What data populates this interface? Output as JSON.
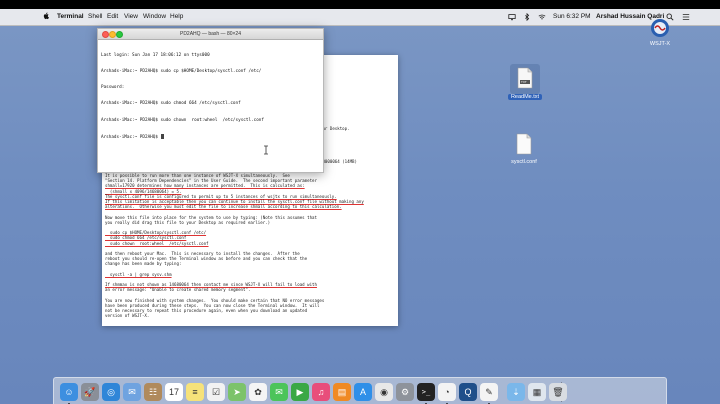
{
  "menubar": {
    "app_name": "Terminal",
    "menus": [
      "Shell",
      "Edit",
      "View",
      "Window",
      "Help"
    ],
    "clock": "Sun 6:32 PM",
    "user": "Arshad Hussain Qadri"
  },
  "desktop_icons": [
    {
      "label": "WSJT-X"
    },
    {
      "label": "ReadMe.txt",
      "badge": "TXT"
    },
    {
      "label": "sysctl.conf"
    }
  ],
  "terminal": {
    "title": "PD2AHQ — bash — 80×24",
    "lines": [
      "Last login: Sun Jan 17 18:06:12 on ttys000",
      "Arshads-iMac:~ PD2AHQ$ sudo cp $HOME/Desktop/sysctl.conf /etc/",
      "Password:",
      "Arshads-iMac:~ PD2AHQ$ sudo chmod 664 /etc/sysctl.conf",
      "Arshads-iMac:~ PD2AHQ$ sudo chown  root:wheel  /etc/sysctl.conf",
      "Arshads-iMac:~ PD2AHQ$ "
    ]
  },
  "readme": {
    "right_fragments": [
      "our Desktop.",
      "",
      "",
      "",
      "",
      "",
      "",
      "",
      "",
      "",
      "",
      "",
      "",
      "",
      "",
      "",
      "",
      "",
      "",
      "",
      "",
      "",
      "",
      "",
      "",
      "",
      "",
      "",
      "",
      "",
      "",
      "",
      "",
      "",
      "",
      "",
      "",
      "",
      "",
      "",
      "",
      "",
      "",
      "",
      "",
      "",
      "",
      "",
      "",
      ""
    ],
    "right_fragment_1": "our Desktop.",
    "right_fragment_2": "60000064 (14MB)",
    "lines": [
      "It is possible to run more than one instance of WSJT-X simultaneously.  See",
      "\"Section 14. Platform Dependencies\" in the User Guide.  The second important parameter",
      "shmall=17920 determines how many instances are permitted.  This is calculated as:",
      "  (shmall x 4096/14680064) = 5.",
      "The sysctl.conf file is configured to permit up to 5 instances of wsjtx to run simultaneously.",
      "If this limitation is acceptable then you can continue to install the sysctl.conf file without making any",
      "alterations.  Otherwise you must edit the file to increase shmall according to this calculation.",
      "",
      "Now move this file into place for the system to use by typing: (Note this assumes that",
      "you really did drag this file to your Desktop as required earlier.)",
      "",
      "  sudo cp $HOME/Desktop/sysctl.conf /etc/",
      "  sudo chmod 664 /etc/sysctl.conf",
      "  sudo chown  root:wheel  /etc/sysctl.conf",
      "",
      "and then reboot your Mac.  This is necessary to install the changes.  After the",
      "reboot you should re-open the Terminal window as before and you can check that the",
      "change has been made by typing:",
      "",
      "  sysctl -a | grep sysv.shm",
      "",
      "If shmmax is not shown as 14680064 then contact me since WSJT-X will fail to load with",
      "an error message: \"Unable to create shared memory segment\".",
      "",
      "You are now finished with system changes.  You should make certain that NO error messages",
      "have been produced during these steps.  You can now close the Terminal window.  It will",
      "not be necessary to repeat this procedure again, even when you download an updated",
      "version of WSJT-X."
    ]
  },
  "dock_items": [
    {
      "name": "finder",
      "color": "#3d8fe0",
      "glyph": "☺"
    },
    {
      "name": "launchpad",
      "color": "#8a8f98",
      "glyph": "🚀"
    },
    {
      "name": "safari",
      "color": "#2f86d8",
      "glyph": "◎"
    },
    {
      "name": "mail",
      "color": "#6fa3e0",
      "glyph": "✉"
    },
    {
      "name": "contacts",
      "color": "#b08a5c",
      "glyph": "☷"
    },
    {
      "name": "calendar",
      "color": "#ffffff",
      "glyph": "17",
      "dark": true
    },
    {
      "name": "notes",
      "color": "#f6e27a",
      "glyph": "≡",
      "dark": true
    },
    {
      "name": "reminders",
      "color": "#f2f2f2",
      "glyph": "☑",
      "dark": true
    },
    {
      "name": "maps",
      "color": "#7cc36a",
      "glyph": "➤"
    },
    {
      "name": "photos",
      "color": "#f5f5f5",
      "glyph": "✿",
      "dark": true
    },
    {
      "name": "messages",
      "color": "#4cc45a",
      "glyph": "✉"
    },
    {
      "name": "facetime",
      "color": "#3aa845",
      "glyph": "▶"
    },
    {
      "name": "itunes",
      "color": "#e84e7b",
      "glyph": "♫"
    },
    {
      "name": "ibooks",
      "color": "#f08a24",
      "glyph": "▤"
    },
    {
      "name": "app-store",
      "color": "#2f8fe8",
      "glyph": "A"
    },
    {
      "name": "chrome",
      "color": "#e8e8e8",
      "glyph": "◉",
      "dark": true
    },
    {
      "name": "system-preferences",
      "color": "#8e939b",
      "glyph": "⚙"
    },
    {
      "name": "terminal",
      "color": "#222222",
      "glyph": ">_"
    },
    {
      "name": "wsjt-x",
      "color": "#f3f3f3",
      "glyph": "◔",
      "dark": true
    },
    {
      "name": "quicktime",
      "color": "#1f4f8a",
      "glyph": "Q"
    },
    {
      "name": "textedit",
      "color": "#f4f4f4",
      "glyph": "✎",
      "dark": true
    },
    {
      "name": "downloads-folder",
      "color": "#7ab7ea",
      "glyph": "⇣"
    },
    {
      "name": "documents-stack",
      "color": "#dfe6ee",
      "glyph": "▦",
      "dark": true
    },
    {
      "name": "trash",
      "color": "#d9dde2",
      "glyph": "🗑",
      "dark": true
    }
  ]
}
